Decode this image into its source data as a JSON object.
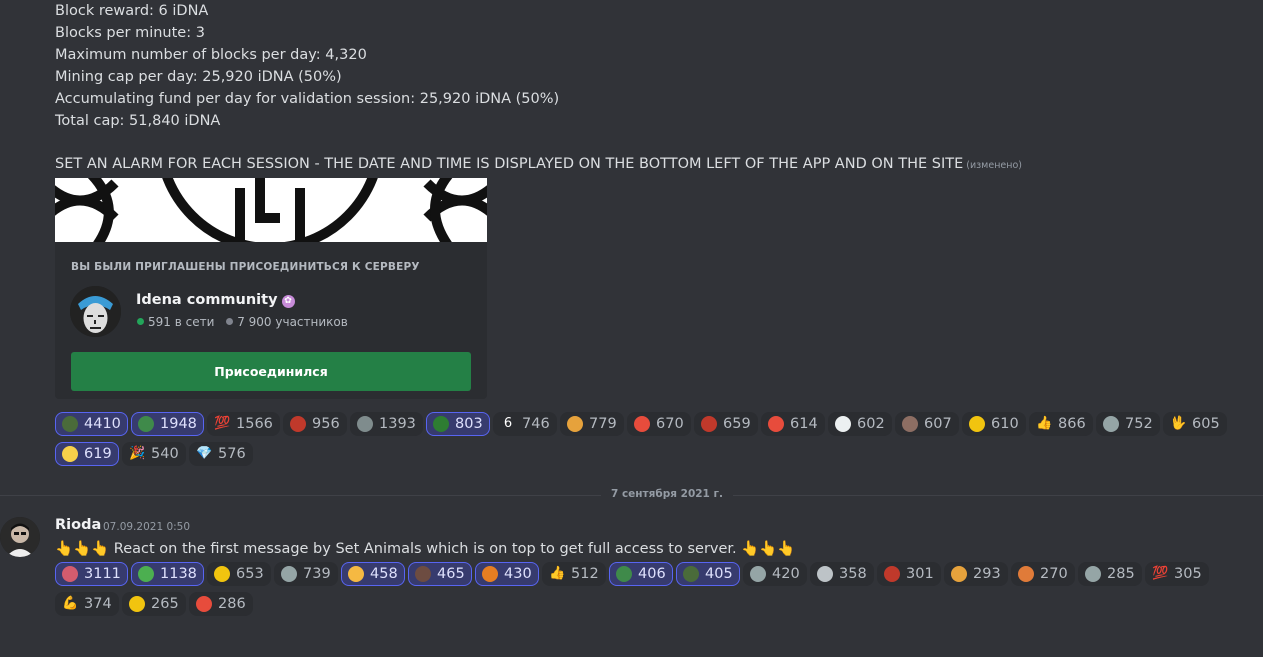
{
  "message1": {
    "lines": [
      "Block reward: 6 iDNA",
      "Blocks per minute: 3",
      "Maximum number of blocks per day: 4,320",
      "Mining cap per day: 25,920 iDNA (50%)",
      "Accumulating fund per day for validation session: 25,920 iDNA (50%)",
      "Total cap: 51,840 iDNA"
    ],
    "alarm": "SET AN ALARM FOR EACH SESSION - THE DATE AND TIME IS DISPLAYED ON THE BOTTOM LEFT OF THE APP AND ON THE SITE",
    "edited": "(изменено)",
    "invite": {
      "heading": "ВЫ БЫЛИ ПРИГЛАШЕНЫ ПРИСОЕДИНИТЬСЯ К СЕРВЕРУ",
      "server_name": "Idena community",
      "online": "591 в сети",
      "members": "7 900 участников",
      "joined_button": "Присоединился"
    },
    "reactions": [
      {
        "icon": "frog-icon",
        "count": "4410",
        "selected": true,
        "color": "#4a6b3a"
      },
      {
        "icon": "pepe-icon",
        "count": "1948",
        "selected": true,
        "color": "#3f8a4a"
      },
      {
        "icon": "hundred-icon",
        "count": "1566",
        "selected": false,
        "color": "#d93a3a",
        "glyph": "💯"
      },
      {
        "icon": "germany-flag-icon",
        "count": "956",
        "selected": false,
        "color": "#c0392b"
      },
      {
        "icon": "lion-icon",
        "count": "1393",
        "selected": false,
        "color": "#7f8c8d"
      },
      {
        "icon": "dino-icon",
        "count": "803",
        "selected": true,
        "color": "#2e7d32"
      },
      {
        "icon": "six-icon",
        "count": "746",
        "selected": false,
        "color": "#3b88c3",
        "glyph": "6"
      },
      {
        "icon": "lion-face-icon",
        "count": "779",
        "selected": false,
        "color": "#e6a23c"
      },
      {
        "icon": "watermelon-icon",
        "count": "670",
        "selected": false,
        "color": "#e74c3c"
      },
      {
        "icon": "germany-flag-icon",
        "count": "659",
        "selected": false,
        "color": "#c0392b"
      },
      {
        "icon": "angry-face-icon",
        "count": "614",
        "selected": false,
        "color": "#e74c3c"
      },
      {
        "icon": "eyes-icon",
        "count": "602",
        "selected": false,
        "color": "#ecf0f1"
      },
      {
        "icon": "man-face-icon",
        "count": "607",
        "selected": false,
        "color": "#8d6e63"
      },
      {
        "icon": "yum-face-icon",
        "count": "610",
        "selected": false,
        "color": "#f1c40f"
      },
      {
        "icon": "thumbs-up-icon",
        "count": "866",
        "selected": false,
        "color": "#f5b942",
        "glyph": "👍"
      },
      {
        "icon": "lion-icon",
        "count": "752",
        "selected": false,
        "color": "#95a5a6"
      },
      {
        "icon": "vulcan-hand-icon",
        "count": "605",
        "selected": false,
        "color": "#f5b942",
        "glyph": "🖖"
      },
      {
        "icon": "chick-icon",
        "count": "619",
        "selected": true,
        "color": "#f7d04a"
      },
      {
        "icon": "party-popper-icon",
        "count": "540",
        "selected": false,
        "color": "#e05a9b",
        "glyph": "🎉"
      },
      {
        "icon": "diamond-icon",
        "count": "576",
        "selected": false,
        "color": "#5dade2",
        "glyph": "💎"
      }
    ]
  },
  "divider_label": "7 сентября 2021 г.",
  "message2": {
    "author": "Rioda",
    "timestamp": "07.09.2021 0:50",
    "text": "👆👆👆 React on the first message by Set Animals which is on top to get full access to server. 👆👆👆",
    "reactions": [
      {
        "icon": "octopus-icon",
        "count": "3111",
        "selected": true,
        "color": "#d35c6e"
      },
      {
        "icon": "crocodile-icon",
        "count": "1138",
        "selected": true,
        "color": "#4caf50"
      },
      {
        "icon": "dizzy-face-icon",
        "count": "653",
        "selected": false,
        "color": "#f1c40f"
      },
      {
        "icon": "lion-icon",
        "count": "739",
        "selected": false,
        "color": "#95a5a6"
      },
      {
        "icon": "pointing-hand-icon",
        "count": "458",
        "selected": true,
        "color": "#f5b942"
      },
      {
        "icon": "woman-face-icon",
        "count": "465",
        "selected": true,
        "color": "#6d4c41"
      },
      {
        "icon": "pig-icon",
        "count": "430",
        "selected": true,
        "color": "#e67e22"
      },
      {
        "icon": "thumbs-up-icon",
        "count": "512",
        "selected": false,
        "color": "#f5b942",
        "glyph": "👍"
      },
      {
        "icon": "pepe-icon",
        "count": "406",
        "selected": true,
        "color": "#3f8a4a"
      },
      {
        "icon": "frog-icon",
        "count": "405",
        "selected": true,
        "color": "#4a6b3a"
      },
      {
        "icon": "lion-icon",
        "count": "420",
        "selected": false,
        "color": "#95a5a6"
      },
      {
        "icon": "lion-icon",
        "count": "358",
        "selected": false,
        "color": "#bdc3c7"
      },
      {
        "icon": "germany-flag-icon",
        "count": "301",
        "selected": false,
        "color": "#c0392b"
      },
      {
        "icon": "lion-face-icon",
        "count": "293",
        "selected": false,
        "color": "#e6a23c"
      },
      {
        "icon": "tiger-icon",
        "count": "270",
        "selected": false,
        "color": "#e07b39"
      },
      {
        "icon": "lion-icon",
        "count": "285",
        "selected": false,
        "color": "#95a5a6"
      },
      {
        "icon": "hundred-icon",
        "count": "305",
        "selected": false,
        "color": "#d93a3a",
        "glyph": "💯"
      },
      {
        "icon": "flexed-biceps-icon",
        "count": "374",
        "selected": false,
        "color": "#f5b942",
        "glyph": "💪"
      },
      {
        "icon": "dizzy-face-icon",
        "count": "265",
        "selected": false,
        "color": "#f1c40f"
      },
      {
        "icon": "watermelon-icon",
        "count": "286",
        "selected": false,
        "color": "#e74c3c"
      }
    ]
  }
}
